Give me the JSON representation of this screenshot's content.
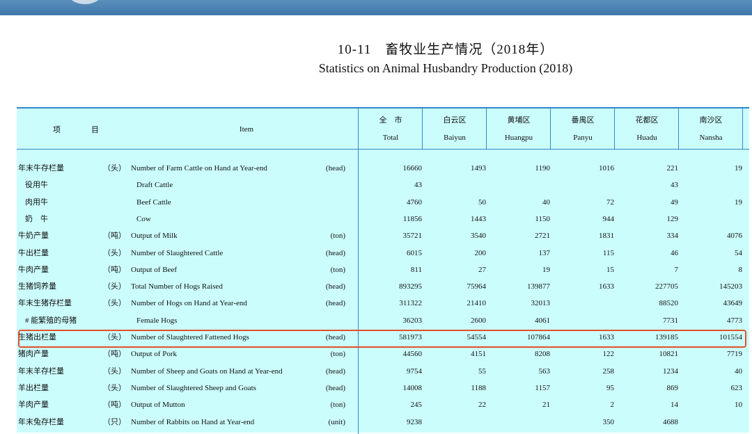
{
  "title": {
    "cn": "10-11　畜牧业生产情况（2018年）",
    "en": "Statistics on Animal Husbandry Production (2018)"
  },
  "header": {
    "col_xiang": "项　　　　目",
    "col_item": "Item",
    "regions": [
      {
        "cn": "全　市",
        "en": "Total"
      },
      {
        "cn": "白云区",
        "en": "Baiyun"
      },
      {
        "cn": "黄埔区",
        "en": "Huangpu"
      },
      {
        "cn": "番禺区",
        "en": "Panyu"
      },
      {
        "cn": "花都区",
        "en": "Huadu"
      },
      {
        "cn": "南沙区",
        "en": "Nansha"
      }
    ]
  },
  "rows": [
    {
      "cn": "年末牛存栏量",
      "unit": "（头）",
      "item": "Number of Farm Cattle on Hand at Year-end",
      "munit": "(head)",
      "v": [
        "16660",
        "1493",
        "1190",
        "1016",
        "221",
        "19"
      ]
    },
    {
      "cn": "役用牛",
      "unit": "",
      "item": "Draft Cattle",
      "munit": "",
      "v": [
        "43",
        "",
        "",
        "",
        "43",
        ""
      ],
      "sub": true
    },
    {
      "cn": "肉用牛",
      "unit": "",
      "item": "Beef Cattle",
      "munit": "",
      "v": [
        "4760",
        "50",
        "40",
        "72",
        "49",
        "19"
      ],
      "sub": true
    },
    {
      "cn": "奶　牛",
      "unit": "",
      "item": "Cow",
      "munit": "",
      "v": [
        "11856",
        "1443",
        "1150",
        "944",
        "129",
        ""
      ],
      "sub": true
    },
    {
      "cn": "牛奶产量",
      "unit": "（吨）",
      "item": "Output of Milk",
      "munit": "(ton)",
      "v": [
        "35721",
        "3540",
        "2721",
        "1831",
        "334",
        "4076"
      ]
    },
    {
      "cn": "牛出栏量",
      "unit": "（头）",
      "item": "Number of Slaughtered Cattle",
      "munit": "(head)",
      "v": [
        "6015",
        "200",
        "137",
        "115",
        "46",
        "54"
      ]
    },
    {
      "cn": "牛肉产量",
      "unit": "（吨）",
      "item": "Output of Beef",
      "munit": "(ton)",
      "v": [
        "811",
        "27",
        "19",
        "15",
        "7",
        "8"
      ]
    },
    {
      "cn": "生猪饲养量",
      "unit": "（头）",
      "item": "Total Number of Hogs Raised",
      "munit": "(head)",
      "v": [
        "893295",
        "75964",
        "139877",
        "1633",
        "227705",
        "145203"
      ]
    },
    {
      "cn": "年末生猪存栏量",
      "unit": "（头）",
      "item": "Number of Hogs on Hand at Year-end",
      "munit": "(head)",
      "v": [
        "311322",
        "21410",
        "32013",
        "",
        "88520",
        "43649"
      ]
    },
    {
      "cn": "# 能繁殖的母猪",
      "unit": "",
      "item": "Female Hogs",
      "munit": "",
      "v": [
        "36203",
        "2600",
        "4061",
        "",
        "7731",
        "4773"
      ],
      "sub": true
    },
    {
      "cn": "生猪出栏量",
      "unit": "（头）",
      "item": "Number of Slaughtered Fattened Hogs",
      "munit": "(head)",
      "v": [
        "581973",
        "54554",
        "107864",
        "1633",
        "139185",
        "101554"
      ]
    },
    {
      "cn": "猪肉产量",
      "unit": "（吨）",
      "item": "Output of Pork",
      "munit": "(ton)",
      "v": [
        "44560",
        "4151",
        "8208",
        "122",
        "10821",
        "7719"
      ]
    },
    {
      "cn": "年末羊存栏量",
      "unit": "（头）",
      "item": "Number of Sheep and Goats on Hand at Year-end",
      "munit": "(head)",
      "v": [
        "9754",
        "55",
        "563",
        "258",
        "1234",
        "40"
      ]
    },
    {
      "cn": "羊出栏量",
      "unit": "（头）",
      "item": "Number of Slaughtered Sheep and Goats",
      "munit": "(head)",
      "v": [
        "14008",
        "1188",
        "1157",
        "95",
        "869",
        "623"
      ]
    },
    {
      "cn": "羊肉产量",
      "unit": "（吨）",
      "item": "Output of Mutton",
      "munit": "(ton)",
      "v": [
        "245",
        "22",
        "21",
        "2",
        "14",
        "10"
      ]
    },
    {
      "cn": "年末兔存栏量",
      "unit": "（只）",
      "item": "Number of Rabbits on Hand at Year-end",
      "munit": "(unit)",
      "v": [
        "9238",
        "",
        "",
        "350",
        "4688",
        ""
      ]
    }
  ],
  "colors": {
    "accent": "#2f86c6",
    "sheet": "#ccfdfd",
    "highlight": "#e0502a"
  }
}
